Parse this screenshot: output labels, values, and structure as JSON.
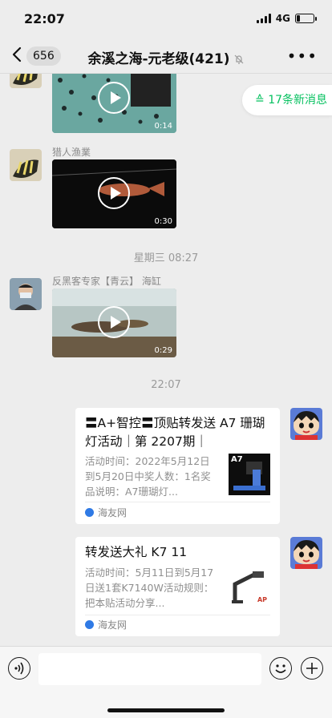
{
  "status_bar": {
    "time": "22:07",
    "network": "4G"
  },
  "nav": {
    "back_count": "656",
    "title": "余溪之海-元老级(421)",
    "more_icon": "more-dots-icon",
    "mute_icon": "bell-slash-icon"
  },
  "new_messages": {
    "label": "17条新消息",
    "color": "#07c160"
  },
  "messages": [
    {
      "type": "video",
      "duration": "0:14"
    },
    {
      "type": "video",
      "sender": "猎人渔業",
      "duration": "0:30"
    },
    {
      "type": "video",
      "sender": "反黑客专家【青云】 海缸",
      "duration": "0:29"
    }
  ],
  "timestamps": [
    "星期三 08:27",
    "22:07"
  ],
  "cards": [
    {
      "title": "〓A+智控〓顶贴转发送 A7 珊瑚灯活动｜第 2207期｜",
      "desc": "活动时间：2022年5月12日到5月20日中奖人数：1名奖品说明：A7珊瑚灯...",
      "thumb_label": "A7",
      "source": "海友网"
    },
    {
      "title": "转发送大礼 K7 11",
      "desc": "活动时间：5月11日到5月17日送1套K7140W活动规则：把本贴活动分享...",
      "thumb_label": "AP",
      "source": "海友网"
    }
  ],
  "input": {
    "placeholder": ""
  }
}
